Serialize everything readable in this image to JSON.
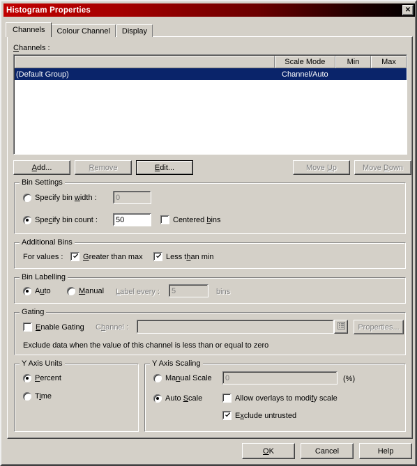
{
  "window": {
    "title": "Histogram Properties",
    "close_label": "✕"
  },
  "tabs": [
    {
      "label": "Channels",
      "active": true
    },
    {
      "label": "Colour Channel",
      "active": false
    },
    {
      "label": "Display",
      "active": false
    }
  ],
  "channels_section": {
    "label": "Channels :",
    "columns": [
      "",
      "Scale Mode",
      "Min",
      "Max"
    ],
    "rows": [
      {
        "name": "(Default Group)",
        "scale_mode": "Channel/Auto",
        "min": "",
        "max": "",
        "selected": true
      }
    ],
    "buttons": {
      "add": "Add...",
      "remove": "Remove",
      "edit": "Edit...",
      "move_up": "Move Up",
      "move_down": "Move Down"
    }
  },
  "bin_settings": {
    "title": "Bin Settings",
    "specify_bin_width_label": "Specify bin width :",
    "specify_bin_width_selected": false,
    "bin_width_value": "0",
    "specify_bin_count_label": "Specify bin count :",
    "specify_bin_count_selected": true,
    "bin_count_value": "50",
    "centered_bins_label": "Centered bins",
    "centered_bins_checked": false
  },
  "additional_bins": {
    "title": "Additional Bins",
    "for_values_label": "For values :",
    "greater_than_max_label": "Greater than max",
    "greater_than_max_checked": true,
    "less_than_min_label": "Less than min",
    "less_than_min_checked": true
  },
  "bin_labelling": {
    "title": "Bin Labelling",
    "auto_label": "Auto",
    "auto_selected": true,
    "manual_label": "Manual",
    "manual_selected": false,
    "label_every_label": "Label every :",
    "label_every_value": "5",
    "bins_label": "bins"
  },
  "gating": {
    "title": "Gating",
    "enable_label": "Enable Gating",
    "enable_checked": false,
    "channel_label": "Channel :",
    "channel_value": "",
    "browse_icon": "list-icon",
    "properties_label": "Properties...",
    "note": "Exclude data when the value of this channel is less than or equal to zero"
  },
  "y_axis_units": {
    "title": "Y Axis Units",
    "percent_label": "Percent",
    "percent_selected": true,
    "time_label": "Time",
    "time_selected": false
  },
  "y_axis_scaling": {
    "title": "Y Axis Scaling",
    "manual_scale_label": "Manual Scale",
    "manual_scale_selected": false,
    "manual_scale_value": "0",
    "percent_unit_label": "(%)",
    "auto_scale_label": "Auto Scale",
    "auto_scale_selected": true,
    "allow_overlays_label": "Allow overlays to modify scale",
    "allow_overlays_checked": false,
    "exclude_untrusted_label": "Exclude untrusted",
    "exclude_untrusted_checked": true
  },
  "footer": {
    "ok": "OK",
    "cancel": "Cancel",
    "help": "Help"
  },
  "colors": {
    "titlebar_start": "#c00000",
    "titlebar_end": "#000000",
    "face": "#d4d0c8",
    "selection": "#0a246a",
    "disabled_text": "#808080"
  }
}
